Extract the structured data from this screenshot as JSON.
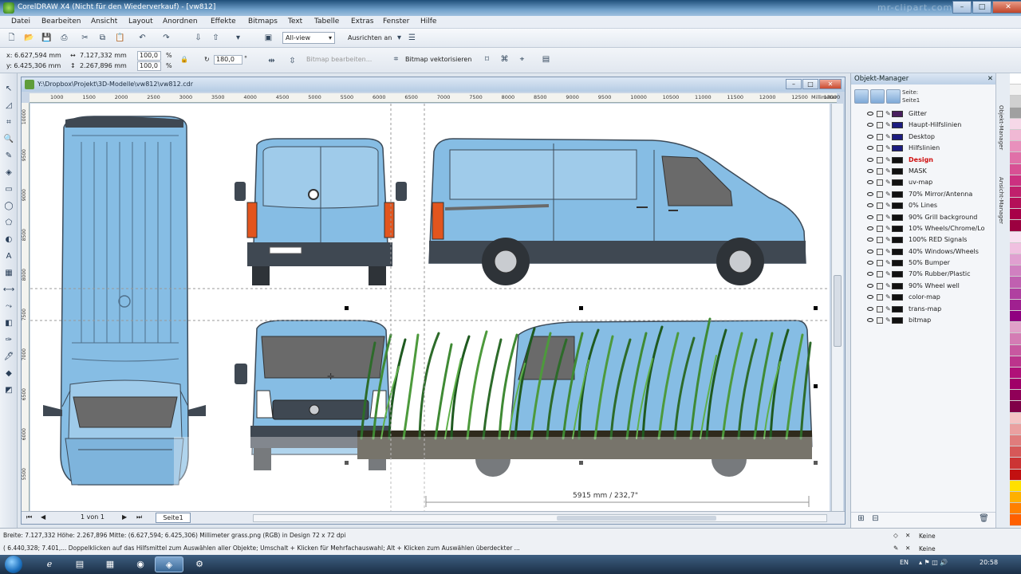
{
  "window": {
    "title": "CorelDRAW X4 (Nicht für den Wiederverkauf) - [vw812]",
    "watermark": "mr-clipart.com"
  },
  "window_controls": {
    "minimize": "–",
    "maximize": "□",
    "close": "✕"
  },
  "menu": [
    "Datei",
    "Bearbeiten",
    "Ansicht",
    "Layout",
    "Anordnen",
    "Effekte",
    "Bitmaps",
    "Text",
    "Tabelle",
    "Extras",
    "Fenster",
    "Hilfe"
  ],
  "toolbar": {
    "zoom_select": "All-view",
    "snap_label": "Ausrichten an"
  },
  "propbar": {
    "x": "x: 6.627,594 mm",
    "y": "y: 6.425,306 mm",
    "w": "7.127,332 mm",
    "h": "2.267,896 mm",
    "scale_x": "100,0",
    "scale_y": "100,0",
    "pct": "%",
    "rotation": "180,0",
    "deg": "°",
    "edit_bitmap": "Bitmap bearbeiten...",
    "trace_bitmap": "Bitmap vektorisieren"
  },
  "document": {
    "title": "Y:\\Dropbox\\Projekt\\3D-Modelle\\vw812\\vw812.cdr"
  },
  "ruler": {
    "h_labels": [
      "1000",
      "1500",
      "2000",
      "2500",
      "3000",
      "3500",
      "4000",
      "4500",
      "5000",
      "5500",
      "6000",
      "6500",
      "7000",
      "7500",
      "8000",
      "8500",
      "9000",
      "9500",
      "10000",
      "10500",
      "11000",
      "11500",
      "12000",
      "12500",
      "13000"
    ],
    "h_unit": "Millimeter",
    "v_labels": [
      "10000",
      "9500",
      "9000",
      "8500",
      "8000",
      "7500",
      "7000",
      "6500",
      "6000",
      "5500"
    ]
  },
  "canvas": {
    "dimension_label": "5915 mm / 232,7\""
  },
  "pagebar": {
    "page_of": "1 von 1",
    "page_tab": "Seite1"
  },
  "object_manager": {
    "title": "Objekt-Manager",
    "page_label": "Seite:",
    "page_name": "Seite1",
    "layers": [
      {
        "name": "Gitter",
        "color": "#4a2060",
        "red": false
      },
      {
        "name": "Haupt-Hilfslinien",
        "color": "#1c1c80",
        "red": false
      },
      {
        "name": "Desktop",
        "color": "#1c1c80",
        "red": false
      },
      {
        "name": "Hilfslinien",
        "color": "#1c1c80",
        "red": false
      },
      {
        "name": "Design",
        "color": "#111111",
        "red": true
      },
      {
        "name": "MASK",
        "color": "#111111",
        "red": false
      },
      {
        "name": "uv-map",
        "color": "#111111",
        "red": false
      },
      {
        "name": "70% Mirror/Antenna",
        "color": "#111111",
        "red": false
      },
      {
        "name": "0% Lines",
        "color": "#111111",
        "red": false
      },
      {
        "name": "90% Grill background",
        "color": "#111111",
        "red": false
      },
      {
        "name": "10% Wheels/Chrome/Lo",
        "color": "#111111",
        "red": false
      },
      {
        "name": "100% RED Signals",
        "color": "#111111",
        "red": false
      },
      {
        "name": "40% Windows/Wheels",
        "color": "#111111",
        "red": false
      },
      {
        "name": "50% Bumper",
        "color": "#111111",
        "red": false
      },
      {
        "name": "70% Rubber/Plastic",
        "color": "#111111",
        "red": false
      },
      {
        "name": "90% Wheel well",
        "color": "#111111",
        "red": false
      },
      {
        "name": "color-map",
        "color": "#111111",
        "red": false
      },
      {
        "name": "trans-map",
        "color": "#111111",
        "red": false
      },
      {
        "name": "bitmap",
        "color": "#111111",
        "red": false
      }
    ]
  },
  "side_tabs": [
    "Objekt-Manager",
    "Ansicht-Manager"
  ],
  "palette": [
    "#ffffff",
    "#f2f2f2",
    "#d0d0d0",
    "#a0a0a0",
    "#f6d8e8",
    "#f0b8d4",
    "#e890bc",
    "#e070a8",
    "#d85094",
    "#cc3080",
    "#c0206c",
    "#b41058",
    "#a80048",
    "#9c0040",
    "#f8e0f0",
    "#f0c0e0",
    "#e0a0d0",
    "#d080c0",
    "#c060b0",
    "#b040a0",
    "#a02090",
    "#900080",
    "#e0a0c8",
    "#d47cb4",
    "#c858a0",
    "#bc348c",
    "#b01078",
    "#a00068",
    "#900058",
    "#800048",
    "#f4c4c4",
    "#eaa0a0",
    "#e07c7c",
    "#d65858",
    "#cc3434",
    "#c21010",
    "#ffe000",
    "#ffb000",
    "#ff8000",
    "#ff6000"
  ],
  "status": {
    "line1": "Breite: 7.127,332  Höhe: 2.267,896  Mitte: (6.627,594; 6.425,306) Millimeter          grass.png (RGB) in Design 72 x 72 dpi",
    "line2": "( 6.440,328; 7.401,...  Doppelklicken auf das Hilfsmittel zum Auswählen aller Objekte; Umschalt + Klicken für Mehrfachauswahl; Alt + Klicken zum Auswählen überdeckter ...",
    "fill_none": "Keine",
    "outline_none": "Keine"
  },
  "taskbar": {
    "lang": "EN",
    "time": "20:58"
  }
}
